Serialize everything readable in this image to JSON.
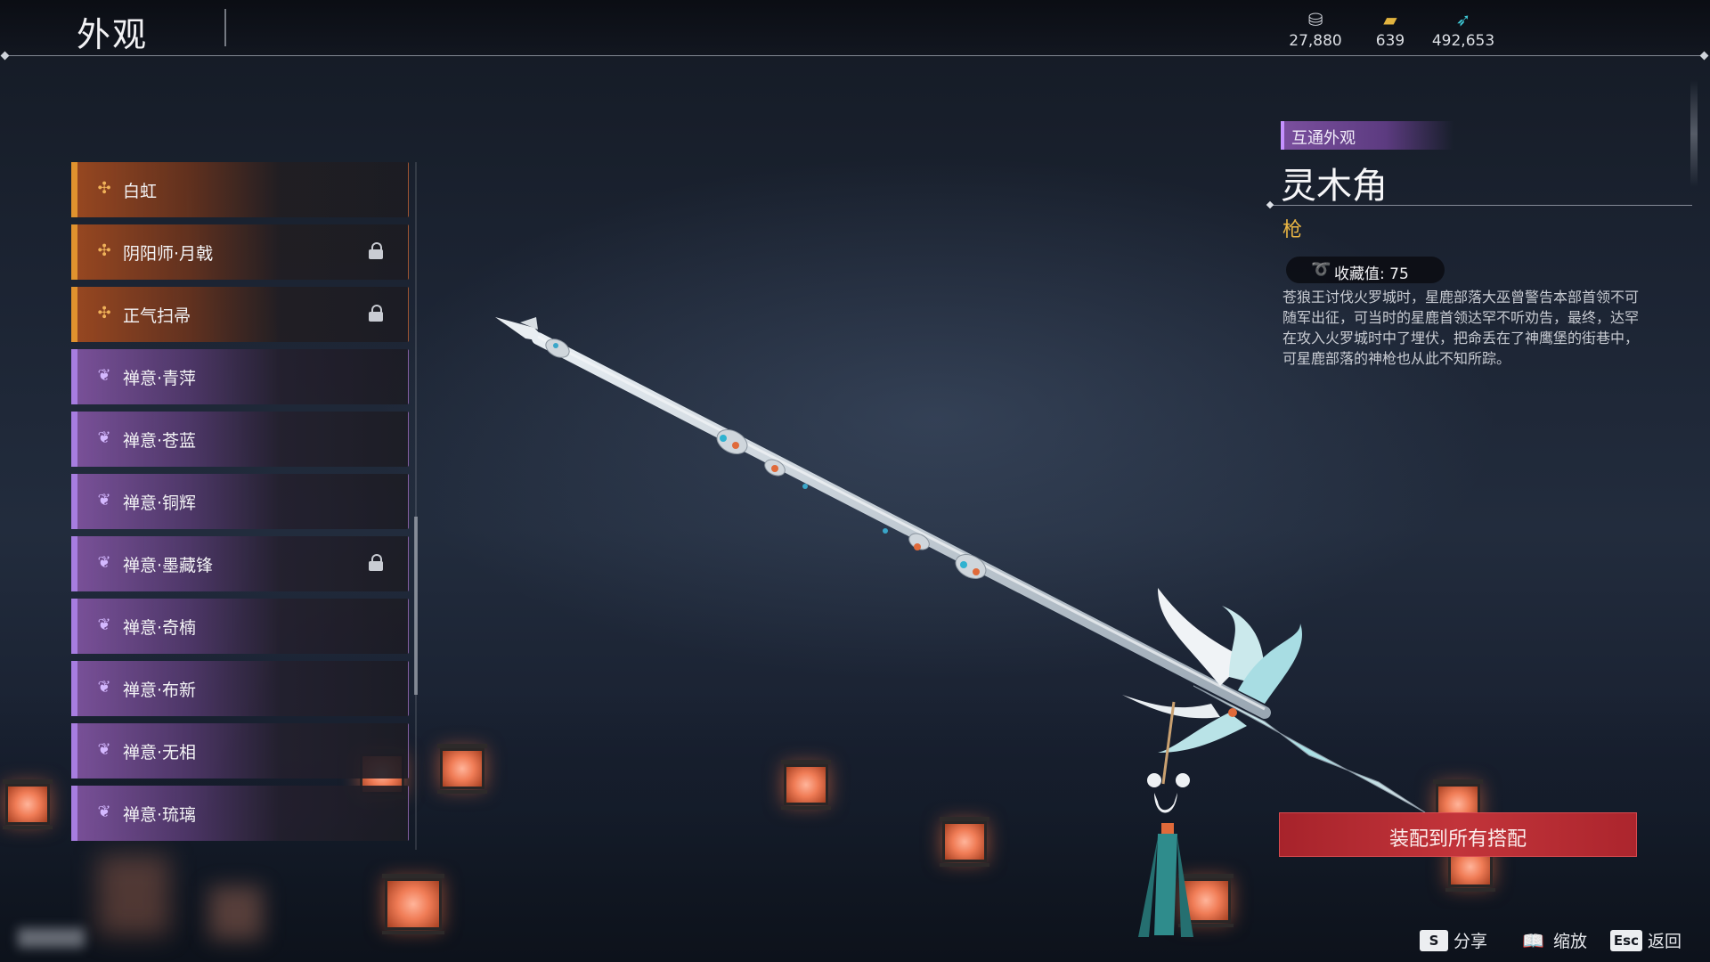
{
  "header": {
    "title": "外观",
    "currencies": [
      {
        "icon": "coin-stack-icon",
        "value": "27,880"
      },
      {
        "icon": "gold-ingot-icon",
        "value": "639"
      },
      {
        "icon": "feather-icon",
        "value": "492,653"
      }
    ]
  },
  "skin_list": {
    "items": [
      {
        "label": "白虹",
        "rarity": "orange",
        "locked": false,
        "selected": true
      },
      {
        "label": "阴阳师·月戟",
        "rarity": "orange",
        "locked": true
      },
      {
        "label": "正气扫帚",
        "rarity": "orange",
        "locked": true
      },
      {
        "label": "禅意·青萍",
        "rarity": "purple",
        "locked": false
      },
      {
        "label": "禅意·苍蓝",
        "rarity": "purple",
        "locked": false
      },
      {
        "label": "禅意·铜辉",
        "rarity": "purple",
        "locked": false
      },
      {
        "label": "禅意·墨藏锋",
        "rarity": "purple",
        "locked": true
      },
      {
        "label": "禅意·奇楠",
        "rarity": "purple",
        "locked": false
      },
      {
        "label": "禅意·布新",
        "rarity": "purple",
        "locked": false
      },
      {
        "label": "禅意·无相",
        "rarity": "purple",
        "locked": false
      },
      {
        "label": "禅意·琉璃",
        "rarity": "purple",
        "locked": false
      }
    ]
  },
  "detail": {
    "tag": "互通外观",
    "name": "灵木角",
    "type": "枪",
    "collection_label": "收藏值: 75",
    "description": "苍狼王讨伐火罗城时，星鹿部落大巫曾警告本部首领不可随军出征，可当时的星鹿首领达罕不听劝告，最终，达罕在攻入火罗城时中了埋伏，把命丢在了神鹰堡的街巷中，可星鹿部落的神枪也从此不知所踪。"
  },
  "equip_button": {
    "label": "装配到所有搭配"
  },
  "hints": [
    {
      "key": "S",
      "label": "分享"
    },
    {
      "key": "📖",
      "label": "缩放"
    },
    {
      "key": "Esc",
      "label": "返回"
    }
  ],
  "colors": {
    "orange_rarity": "#e0922e",
    "purple_rarity": "#a77de0",
    "equip_button": "#b52a31",
    "weapon_type": "#e9b544"
  }
}
